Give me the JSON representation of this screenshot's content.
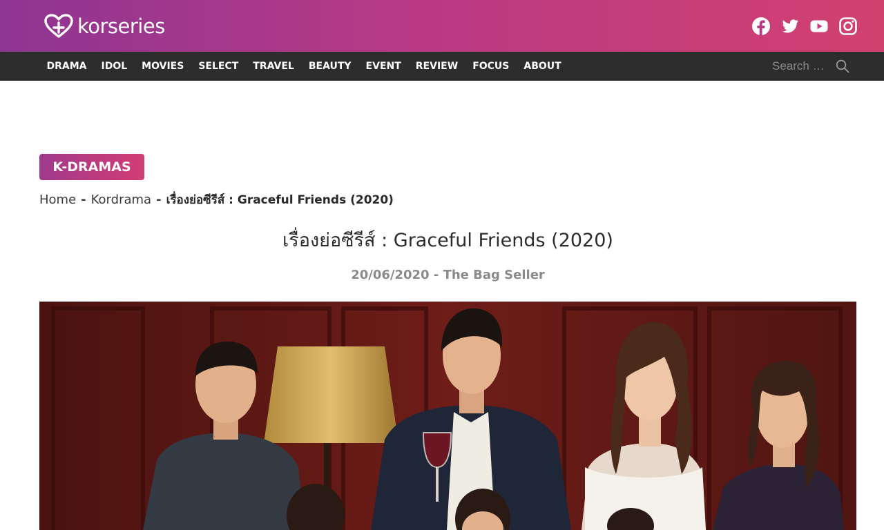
{
  "site": {
    "logo_text": "korseries"
  },
  "social": {
    "icons": [
      "facebook-icon",
      "twitter-icon",
      "youtube-icon",
      "instagram-icon"
    ]
  },
  "nav": {
    "items": [
      "DRAMA",
      "IDOL",
      "MOVIES",
      "SELECT",
      "TRAVEL",
      "BEAUTY",
      "EVENT",
      "REVIEW",
      "FOCUS",
      "ABOUT"
    ],
    "search_placeholder": "Search …"
  },
  "article": {
    "category": "K-DRAMAS",
    "breadcrumb": {
      "home": "Home",
      "section": "Kordrama",
      "current": "เรื่องย่อซีรีส์ : Graceful Friends (2020)",
      "separator": "-"
    },
    "title": "เรื่องย่อซีรีส์ : Graceful Friends (2020)",
    "date": "20/06/2020",
    "meta_separator": "-",
    "author": "The Bag Seller"
  },
  "colors": {
    "header_gradient_start": "#8e3592",
    "header_gradient_end": "#d2406f",
    "nav_background": "#2d2d2d",
    "badge_gradient_start": "#a03a8d",
    "badge_gradient_end": "#d23c74"
  }
}
